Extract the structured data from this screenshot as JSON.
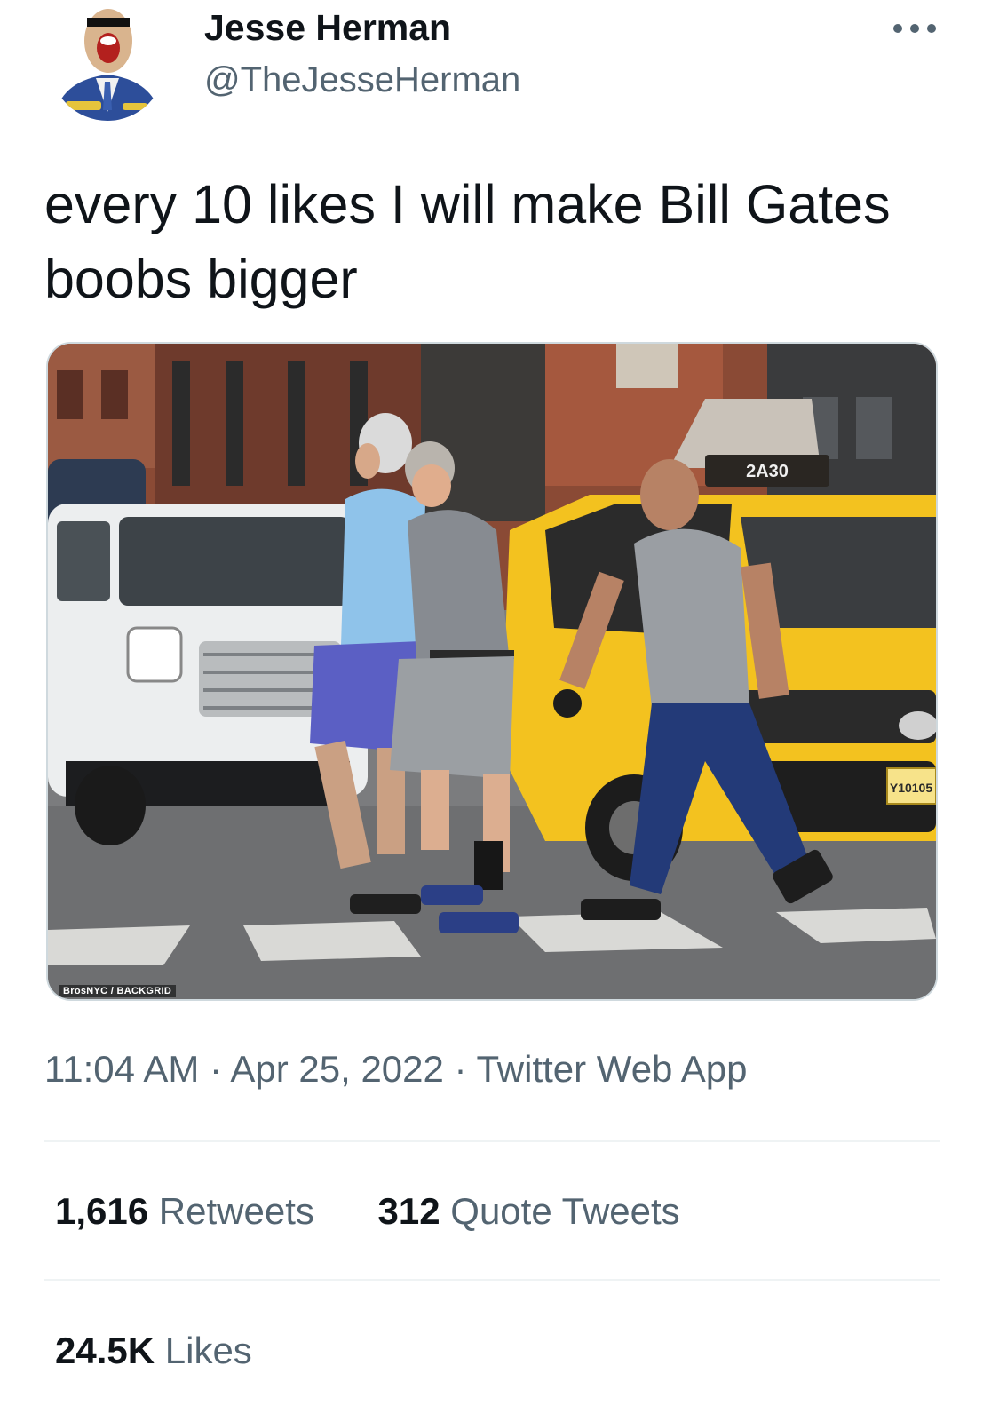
{
  "author": {
    "name": "Jesse Herman",
    "handle": "@TheJesseHerman",
    "avatar_icon": "cartoon-avatar-icon"
  },
  "tweet": {
    "text": "every 10 likes I will make Bill Gates boobs bigger",
    "image_credit": "BrosNYC / BACKGRID",
    "taxi_roof_number": "2A30",
    "taxi_plate": "Y10105"
  },
  "meta": {
    "time": "11:04 AM",
    "separator": " · ",
    "date": "Apr 25, 2022",
    "source": "Twitter Web App"
  },
  "stats": {
    "retweets_count": "1,616",
    "retweets_label": "Retweets",
    "quotes_count": "312",
    "quotes_label": "Quote Tweets",
    "likes_count": "24.5K",
    "likes_label": "Likes"
  },
  "colors": {
    "text_primary": "#0f1419",
    "text_secondary": "#536471",
    "border": "#cfd9de",
    "taxi_yellow": "#f3c21f"
  }
}
